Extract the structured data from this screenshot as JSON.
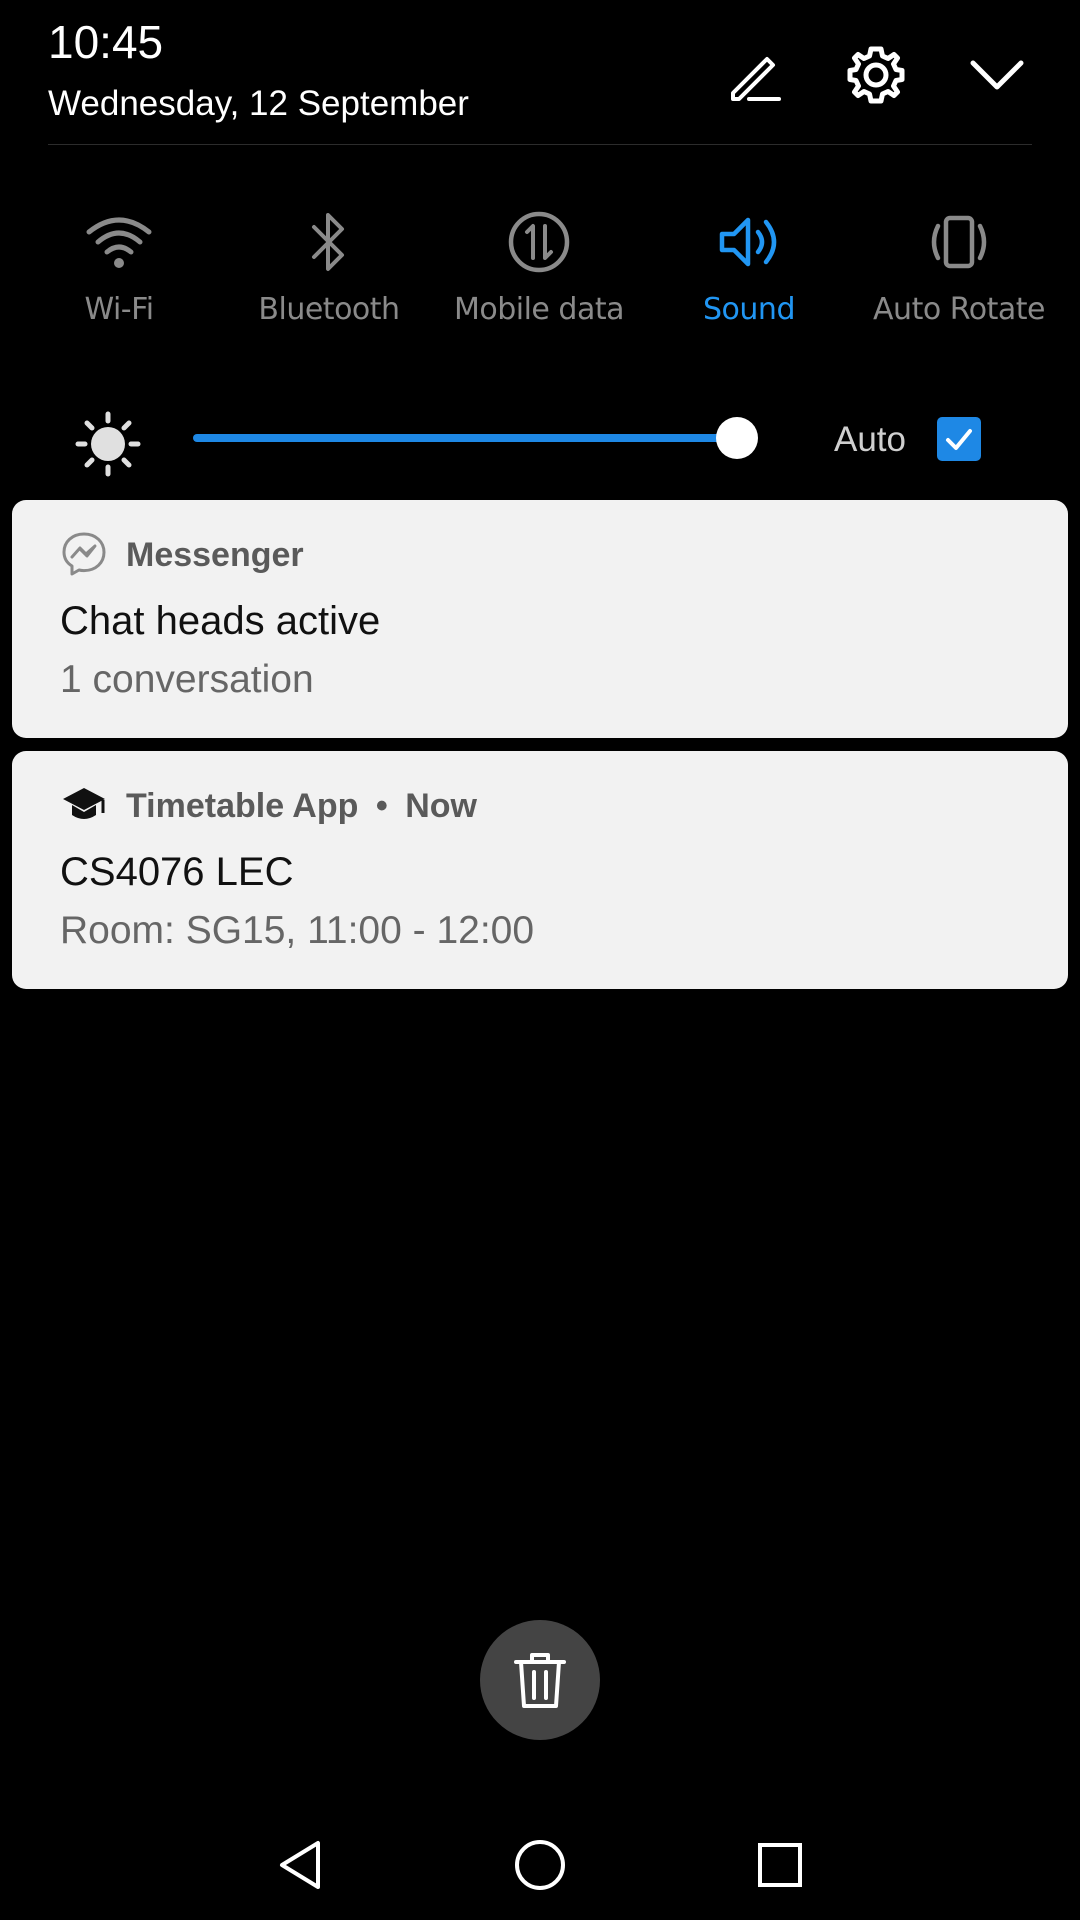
{
  "status": {
    "time": "10:45",
    "date": "Wednesday, 12 September"
  },
  "header_actions": {
    "edit_icon": "pencil-icon",
    "settings_icon": "gear-icon",
    "collapse_icon": "chevron-down-icon"
  },
  "quick_settings": [
    {
      "label": "Wi-Fi",
      "icon": "wifi-icon",
      "active": false
    },
    {
      "label": "Bluetooth",
      "icon": "bluetooth-icon",
      "active": false
    },
    {
      "label": "Mobile data",
      "icon": "mobile-data-icon",
      "active": false
    },
    {
      "label": "Sound",
      "icon": "sound-icon",
      "active": true
    },
    {
      "label": "Auto Rotate",
      "icon": "auto-rotate-icon",
      "active": false
    }
  ],
  "brightness": {
    "level": 0.98,
    "auto_label": "Auto",
    "auto_checked": true
  },
  "notifications": [
    {
      "app": "Messenger",
      "time": "",
      "title": "Chat heads active",
      "body": "1 conversation",
      "icon": "messenger-icon"
    },
    {
      "app": "Timetable App",
      "separator": "•",
      "time": "Now",
      "title": "CS4076 LEC",
      "body": "Room: SG15, 11:00 - 12:00",
      "icon": "graduation-cap-icon"
    }
  ],
  "colors": {
    "background": "#000000",
    "accent": "#2196f3",
    "inactive": "#8a8a8a",
    "card": "#f2f2f2"
  }
}
